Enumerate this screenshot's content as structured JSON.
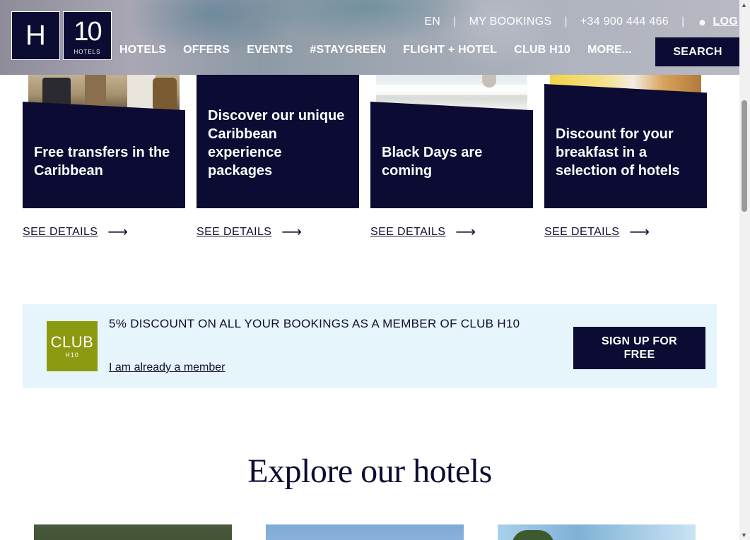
{
  "header": {
    "logo": {
      "letter": "H",
      "number": "10",
      "word": "HOTELS"
    },
    "topbar": {
      "language": "EN",
      "my_bookings": "MY BOOKINGS",
      "phone": "+34 900 444 466",
      "login": "LOG"
    },
    "nav": [
      "HOTELS",
      "OFFERS",
      "EVENTS",
      "#STAYGREEN",
      "FLIGHT + HOTEL",
      "CLUB H10",
      "MORE..."
    ],
    "search_label": "SEARCH"
  },
  "offers": [
    {
      "title": "Free transfers in the Caribbean",
      "cta": "SEE DETAILS"
    },
    {
      "title": "Discover our unique Caribbean experience packages",
      "cta": "SEE DETAILS"
    },
    {
      "title": "Black Days are coming",
      "cta": "SEE DETAILS"
    },
    {
      "title": "Discount for your breakfast in a selection of hotels",
      "cta": "SEE DETAILS"
    }
  ],
  "club": {
    "logo_main": "CLUB",
    "logo_sub": "H10",
    "headline": "5% DISCOUNT ON ALL YOUR BOOKINGS AS A MEMBER OF CLUB H10",
    "member_link": "I am already a member",
    "signup_label": "SIGN UP FOR FREE"
  },
  "explore": {
    "title": "Explore our hotels"
  },
  "colors": {
    "navy": "#0b0b33",
    "club_green": "#8c9a12",
    "club_bg": "#e6f4fb"
  }
}
